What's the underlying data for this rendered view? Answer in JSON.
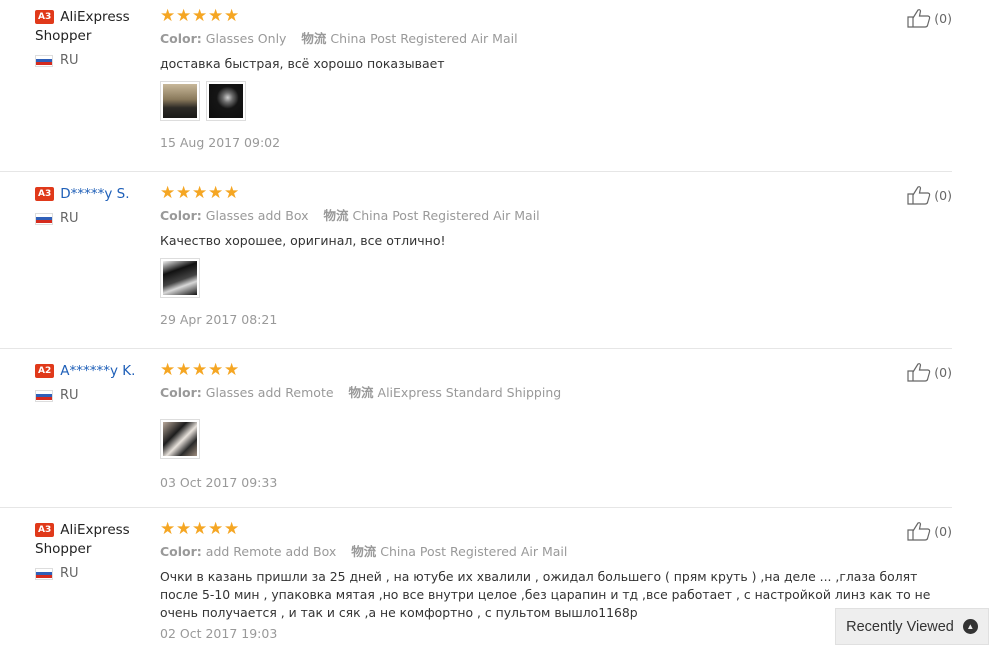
{
  "reviews": [
    {
      "level": "A3",
      "user": "AliExpress Shopper",
      "country": "RU",
      "color_label": "Color:",
      "color": "Glasses Only",
      "ship_label": "物流",
      "shipping": "China Post Registered Air Mail",
      "text": "доставка быстрая, всё хорошо показывает",
      "images": [
        "photo-thumbnail",
        "photo-thumbnail"
      ],
      "date": "15 Aug 2017 09:02",
      "helpful": "(0)"
    },
    {
      "level": "A3",
      "user": "D*****y S.",
      "country": "RU",
      "color_label": "Color:",
      "color": "Glasses add Box",
      "ship_label": "物流",
      "shipping": "China Post Registered Air Mail",
      "text": "Качество хорошее, оригинал, все отлично!",
      "images": [
        "photo-thumbnail"
      ],
      "date": "29 Apr 2017 08:21",
      "helpful": "(0)"
    },
    {
      "level": "A2",
      "user": "A******y K.",
      "country": "RU",
      "color_label": "Color:",
      "color": "Glasses add Remote",
      "ship_label": "物流",
      "shipping": "AliExpress Standard Shipping",
      "text": "",
      "images": [
        "photo-thumbnail"
      ],
      "date": "03 Oct 2017 09:33",
      "helpful": "(0)"
    },
    {
      "level": "A3",
      "user": "AliExpress Shopper",
      "country": "RU",
      "color_label": "Color:",
      "color": "add Remote add Box",
      "ship_label": "物流",
      "shipping": "China Post Registered Air Mail",
      "text": "Очки в казань пришли за 25 дней , на ютубе их хвалили , ожидал большего ( прям круть ) ,на деле ... ,глаза болят после 5-10 мин , упаковка мятая ,но все внутри целое ,без царапин и тд ,все работает , с настройкой линз как то не очень получается , и так и сяк ,а не комфортно , с пультом вышло1168р",
      "images": [],
      "date": "02 Oct 2017 19:03",
      "helpful": "(0)"
    }
  ],
  "recently_viewed": "Recently Viewed",
  "colors": {
    "star": "#f5a623",
    "badge": "#e0391a",
    "link": "#1e5fb8"
  },
  "icons": {
    "helpful": "thumbs-up-icon",
    "recent": "chevron-up-icon",
    "star": "star-icon"
  }
}
